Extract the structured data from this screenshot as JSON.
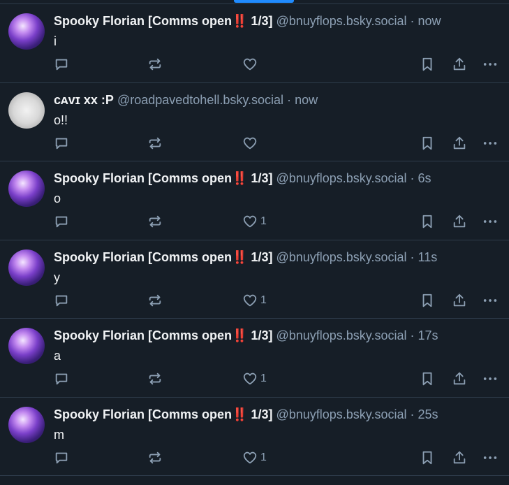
{
  "posts": [
    {
      "name": "Spooky Florian [Comms open‼️ 1/3]",
      "handle": "@bnuyflops.bsky.social",
      "sep": "·",
      "time": "now",
      "text": "i",
      "likes": "",
      "avatar": "spooky"
    },
    {
      "name": "ᴄᴀᴠɪ xx :P",
      "handle": "@roadpavedtohell.bsky.social",
      "sep": "·",
      "time": "now",
      "text": "o!!",
      "likes": "",
      "avatar": "cavi"
    },
    {
      "name": "Spooky Florian [Comms open‼️ 1/3]",
      "handle": "@bnuyflops.bsky.social",
      "sep": "·",
      "time": "6s",
      "text": "o",
      "likes": "1",
      "avatar": "spooky"
    },
    {
      "name": "Spooky Florian [Comms open‼️ 1/3]",
      "handle": "@bnuyflops.bsky.social",
      "sep": "·",
      "time": "11s",
      "text": "y",
      "likes": "1",
      "avatar": "spooky"
    },
    {
      "name": "Spooky Florian [Comms open‼️ 1/3]",
      "handle": "@bnuyflops.bsky.social",
      "sep": "·",
      "time": "17s",
      "text": "a",
      "likes": "1",
      "avatar": "spooky"
    },
    {
      "name": "Spooky Florian [Comms open‼️ 1/3]",
      "handle": "@bnuyflops.bsky.social",
      "sep": "·",
      "time": "25s",
      "text": "m",
      "likes": "1",
      "avatar": "spooky"
    }
  ],
  "colors": {
    "background": "#161e27",
    "accent": "#208bfe",
    "muted": "#8c9fb3",
    "text": "#f1f3f5"
  },
  "icons": {
    "reply": "reply-icon",
    "repost": "repost-icon",
    "like": "heart-icon",
    "bookmark": "bookmark-icon",
    "share": "share-icon",
    "more": "more-icon"
  }
}
